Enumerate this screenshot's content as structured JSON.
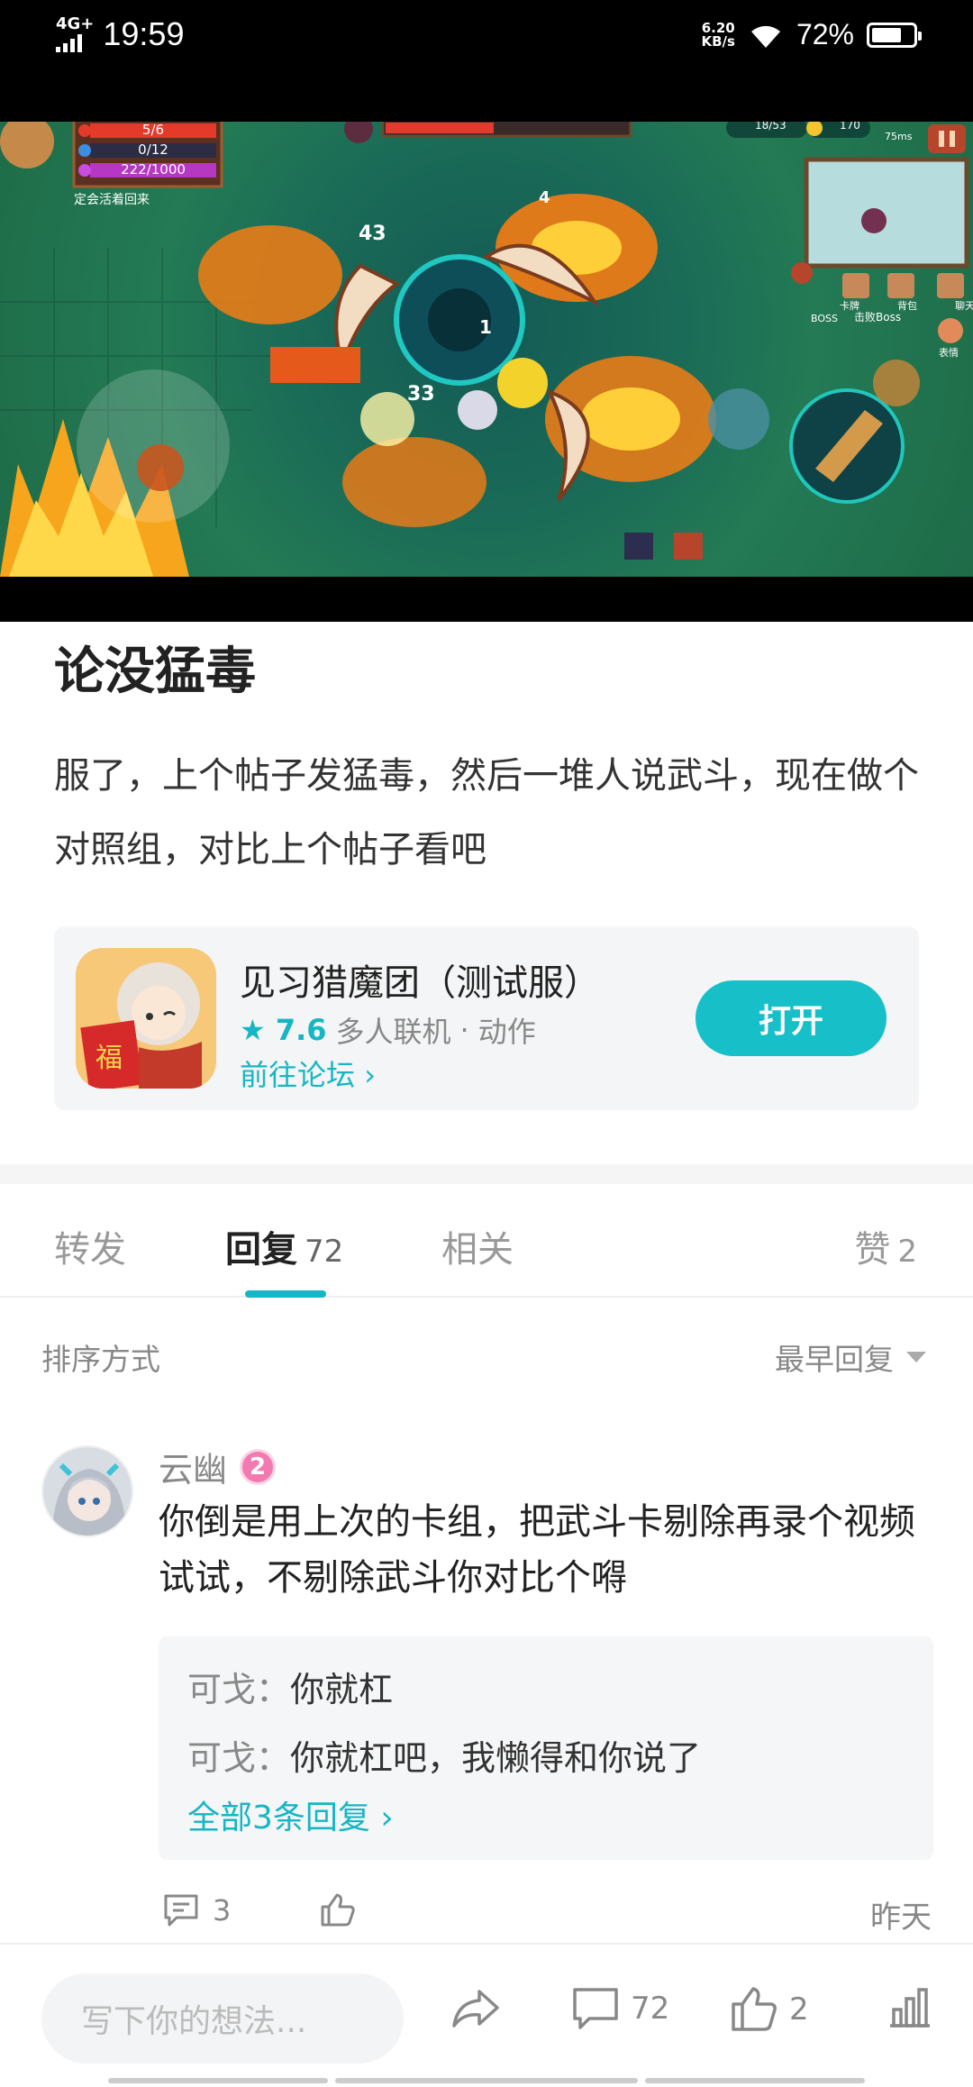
{
  "status_bar": {
    "network": "4G+",
    "time": "19:59",
    "speed_value": "6.20",
    "speed_unit": "KB/s",
    "battery_pct": "72%",
    "battery_level": 0.72
  },
  "game_hud": {
    "hp": "5/6",
    "armor": "0/12",
    "energy": "222/1000",
    "status_text": "定会活着回来",
    "gems": "18/53",
    "coins": "170",
    "ping": "75ms",
    "boss_label": "BOSS",
    "boss_skill": "击败Boss",
    "menu_labels": [
      "卡牌",
      "背包",
      "聊天",
      "表情"
    ],
    "damage_numbers": [
      "43",
      "33",
      "1",
      "4"
    ]
  },
  "post": {
    "title": "论没猛毒",
    "body": "服了，上个帖子发猛毒，然后一堆人说武斗，现在做个对照组，对比上个帖子看吧"
  },
  "app_card": {
    "name": "见习猎魔团（测试服）",
    "rating": "7.6",
    "genres": "多人联机",
    "separator": "·",
    "genre2": "动作",
    "forum_link": "前往论坛",
    "open_label": "打开",
    "accent_color": "#17c0c8"
  },
  "tabs": [
    {
      "label": "转发",
      "count": ""
    },
    {
      "label": "回复",
      "count": "72"
    },
    {
      "label": "相关",
      "count": ""
    },
    {
      "label": "赞",
      "count": "2"
    }
  ],
  "sort": {
    "label": "排序方式",
    "value": "最早回复"
  },
  "comment": {
    "user": "云幽",
    "level": "2",
    "text": "你倒是用上次的卡组，把武斗卡剔除再录个视频试试，不剔除武斗你对比个嘚",
    "replies": [
      {
        "user": "可戈",
        "sep": "：",
        "text": "你就杠"
      },
      {
        "user": "可戈",
        "sep": "：",
        "text": "你就杠吧，我懒得和你说了"
      }
    ],
    "all_replies": "全部3条回复",
    "reply_count": "3",
    "date": "昨天"
  },
  "bottom_bar": {
    "input_placeholder": "写下你的想法...",
    "comment_count": "72",
    "like_count": "2"
  }
}
